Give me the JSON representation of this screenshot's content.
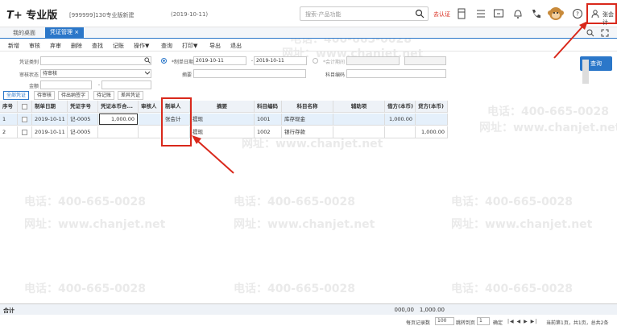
{
  "app": {
    "logo": "T+",
    "edition": "专业版",
    "company": "[999999]130专业版新建",
    "date": "(2019-10-11)"
  },
  "search": {
    "placeholder": "搜索-产品功能"
  },
  "header": {
    "auth_label": "去认证",
    "user_name": "张会计"
  },
  "tabs": [
    {
      "label": "我的桌面"
    },
    {
      "label": "凭证管理"
    }
  ],
  "tab_close": "×",
  "toolbar": {
    "items": [
      "新增",
      "审核",
      "弃审",
      "删除",
      "查找",
      "记账",
      "操作▼",
      "查询",
      "打印▼",
      "导出",
      "退出"
    ]
  },
  "form": {
    "voucher_type_label": "凭证类别",
    "audit_status_label": "审核状态",
    "audit_status_value": "待审核",
    "amount_label": "金额",
    "date_radio_label": "*制单日期",
    "date_from": "2019-10-11",
    "date_to": "2019-10-11",
    "period_radio_label": "*会计期间",
    "summary_label": "摘要",
    "account_label": "科目编码",
    "amount_sep": "-",
    "date_sep": "-",
    "query_button": "查询"
  },
  "filters": [
    "全部凭证",
    "待审核",
    "待出纳签字",
    "待记账",
    "差异凭证"
  ],
  "table": {
    "headers": [
      "序号",
      "",
      "制单日期",
      "凭证字号",
      "凭证本币合...",
      "审核人",
      "制单人",
      "摘要",
      "科目编码",
      "科目名称",
      "辅助项",
      "借方(本币)",
      "贷方(本币)"
    ],
    "rows": [
      {
        "seq": "1",
        "date": "2019-10-11",
        "no": "记-0005",
        "total": "1,000.00",
        "auditor": "",
        "maker": "张会计",
        "summary": "提现",
        "code": "1001",
        "name": "库存现金",
        "aux": "",
        "debit": "1,000.00",
        "credit": ""
      },
      {
        "seq": "2",
        "date": "2019-10-11",
        "no": "记-0005",
        "total": "",
        "auditor": "",
        "maker": "",
        "summary": "提现",
        "code": "1002",
        "name": "银行存款",
        "aux": "",
        "debit": "",
        "credit": "1,000.00"
      }
    ],
    "footer": {
      "label": "合计",
      "debit": "000,00",
      "credit": "1,000.00"
    }
  },
  "pager": {
    "per_page_label": "每页记录数",
    "per_page": "100",
    "goto_label": "跳转到页",
    "goto_page": "1",
    "confirm": "确定",
    "info": "当前第1页，共1页，总共2条"
  },
  "watermark": {
    "phone": "电话：400-665-0028",
    "url": "网址：www.chanjet.net"
  },
  "colors": {
    "accent": "#2b77c9",
    "highlight": "#d9281b"
  }
}
